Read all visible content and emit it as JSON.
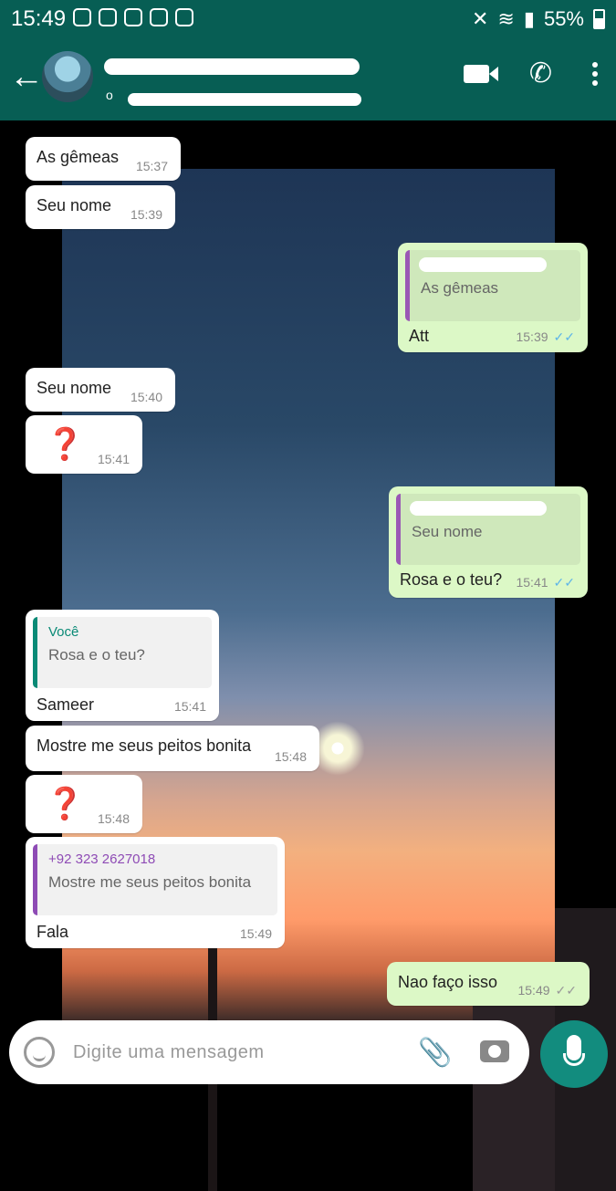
{
  "status_bar": {
    "time": "15:49",
    "battery": "55%"
  },
  "header": {
    "contact_status": "o"
  },
  "messages": [
    {
      "id": "m1",
      "text": "As gêmeas",
      "time": "15:37"
    },
    {
      "id": "m2",
      "text": "Seu nome",
      "time": "15:39"
    },
    {
      "id": "m3",
      "quote_text": "As gêmeas",
      "text": "Att",
      "time": "15:39",
      "ticks": "✓✓"
    },
    {
      "id": "m4",
      "text": "Seu nome",
      "time": "15:40"
    },
    {
      "id": "m5",
      "text": "❓",
      "time": "15:41"
    },
    {
      "id": "m6",
      "quote_text": "Seu nome",
      "text": "Rosa e o teu?",
      "time": "15:41",
      "ticks": "✓✓"
    },
    {
      "id": "m7",
      "quote_author": "Você",
      "quote_text": "Rosa e o teu?",
      "text": "Sameer",
      "time": "15:41"
    },
    {
      "id": "m8",
      "text": "Mostre me seus peitos bonita",
      "time": "15:48"
    },
    {
      "id": "m9",
      "text": "❓",
      "time": "15:48"
    },
    {
      "id": "m10",
      "quote_author": "+92 323 2627018",
      "quote_text": "Mostre me seus peitos bonita",
      "text": "Fala",
      "time": "15:49"
    },
    {
      "id": "m11",
      "text": "Nao faço isso",
      "time": "15:49",
      "ticks": "✓✓"
    }
  ],
  "input": {
    "placeholder": "Digite uma mensagem"
  },
  "icons": [
    "back-arrow-icon",
    "video-call-icon",
    "phone-icon",
    "more-options-icon",
    "emoji-icon",
    "attach-icon",
    "camera-icon",
    "mic-icon"
  ],
  "colors": {
    "header": "#075E54",
    "outgoing_bubble": "#dcf8c6",
    "incoming_bubble": "#ffffff",
    "read_ticks": "#5eb5e8",
    "mic_button": "#128C7E"
  }
}
